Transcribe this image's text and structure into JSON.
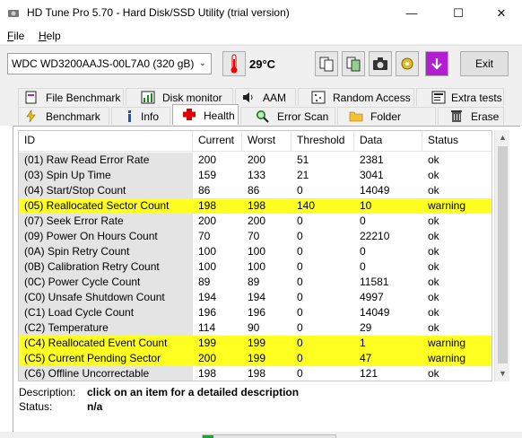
{
  "window": {
    "title": "HD Tune Pro 5.70 - Hard Disk/SSD Utility (trial version)",
    "minimize": "—",
    "maximize": "☐",
    "close": "✕"
  },
  "menu": [
    {
      "label": "File",
      "accel": "F",
      "rest": "ile"
    },
    {
      "label": "Help",
      "accel": "H",
      "rest": "elp"
    }
  ],
  "toolbar": {
    "drive": "WDC WD3200AAJS-00L7A0 (320 gB)",
    "temperature": "29°C",
    "exit_label": "Exit"
  },
  "tabs_top": [
    {
      "label": "File Benchmark",
      "icon": "file-benchmark-icon"
    },
    {
      "label": "Disk monitor",
      "icon": "disk-monitor-icon"
    },
    {
      "label": "AAM",
      "icon": "speaker-icon"
    },
    {
      "label": "Random Access",
      "icon": "random-access-icon"
    },
    {
      "label": "Extra tests",
      "icon": "extra-tests-icon"
    }
  ],
  "tabs_bottom": [
    {
      "label": "Benchmark",
      "icon": "benchmark-icon"
    },
    {
      "label": "Info",
      "icon": "info-icon"
    },
    {
      "label": "Health",
      "icon": "health-cross-icon",
      "active": true
    },
    {
      "label": "Error Scan",
      "icon": "magnifier-icon"
    },
    {
      "label": "Folder Usage",
      "icon": "folder-icon"
    },
    {
      "label": "Erase",
      "icon": "trash-icon"
    }
  ],
  "health_table": {
    "columns": [
      "ID",
      "Current",
      "Worst",
      "Threshold",
      "Data",
      "Status"
    ],
    "rows": [
      {
        "id": "(01) Raw Read Error Rate",
        "current": "200",
        "worst": "200",
        "threshold": "51",
        "data": "2381",
        "status": "ok"
      },
      {
        "id": "(03) Spin Up Time",
        "current": "159",
        "worst": "133",
        "threshold": "21",
        "data": "3041",
        "status": "ok"
      },
      {
        "id": "(04) Start/Stop Count",
        "current": "86",
        "worst": "86",
        "threshold": "0",
        "data": "14049",
        "status": "ok"
      },
      {
        "id": "(05) Reallocated Sector Count",
        "current": "198",
        "worst": "198",
        "threshold": "140",
        "data": "10",
        "status": "warning"
      },
      {
        "id": "(07) Seek Error Rate",
        "current": "200",
        "worst": "200",
        "threshold": "0",
        "data": "0",
        "status": "ok"
      },
      {
        "id": "(09) Power On Hours Count",
        "current": "70",
        "worst": "70",
        "threshold": "0",
        "data": "22210",
        "status": "ok"
      },
      {
        "id": "(0A) Spin Retry Count",
        "current": "100",
        "worst": "100",
        "threshold": "0",
        "data": "0",
        "status": "ok"
      },
      {
        "id": "(0B) Calibration Retry Count",
        "current": "100",
        "worst": "100",
        "threshold": "0",
        "data": "0",
        "status": "ok"
      },
      {
        "id": "(0C) Power Cycle Count",
        "current": "89",
        "worst": "89",
        "threshold": "0",
        "data": "11581",
        "status": "ok"
      },
      {
        "id": "(C0) Unsafe Shutdown Count",
        "current": "194",
        "worst": "194",
        "threshold": "0",
        "data": "4997",
        "status": "ok"
      },
      {
        "id": "(C1) Load Cycle Count",
        "current": "196",
        "worst": "196",
        "threshold": "0",
        "data": "14049",
        "status": "ok"
      },
      {
        "id": "(C2) Temperature",
        "current": "114",
        "worst": "90",
        "threshold": "0",
        "data": "29",
        "status": "ok"
      },
      {
        "id": "(C4) Reallocated Event Count",
        "current": "199",
        "worst": "199",
        "threshold": "0",
        "data": "1",
        "status": "warning"
      },
      {
        "id": "(C5) Current Pending Sector",
        "current": "200",
        "worst": "199",
        "threshold": "0",
        "data": "47",
        "status": "warning"
      },
      {
        "id": "(C6) Offline Uncorrectable",
        "current": "198",
        "worst": "198",
        "threshold": "0",
        "data": "121",
        "status": "ok"
      }
    ]
  },
  "details": {
    "description_label": "Description:",
    "description_value": "click on an item for a detailed description",
    "status_label": "Status:",
    "status_value": "n/a"
  },
  "colors": {
    "warning_row": "#ffff22",
    "id_column_bg": "#e4e4e4",
    "progress_fill": "#06b025"
  }
}
